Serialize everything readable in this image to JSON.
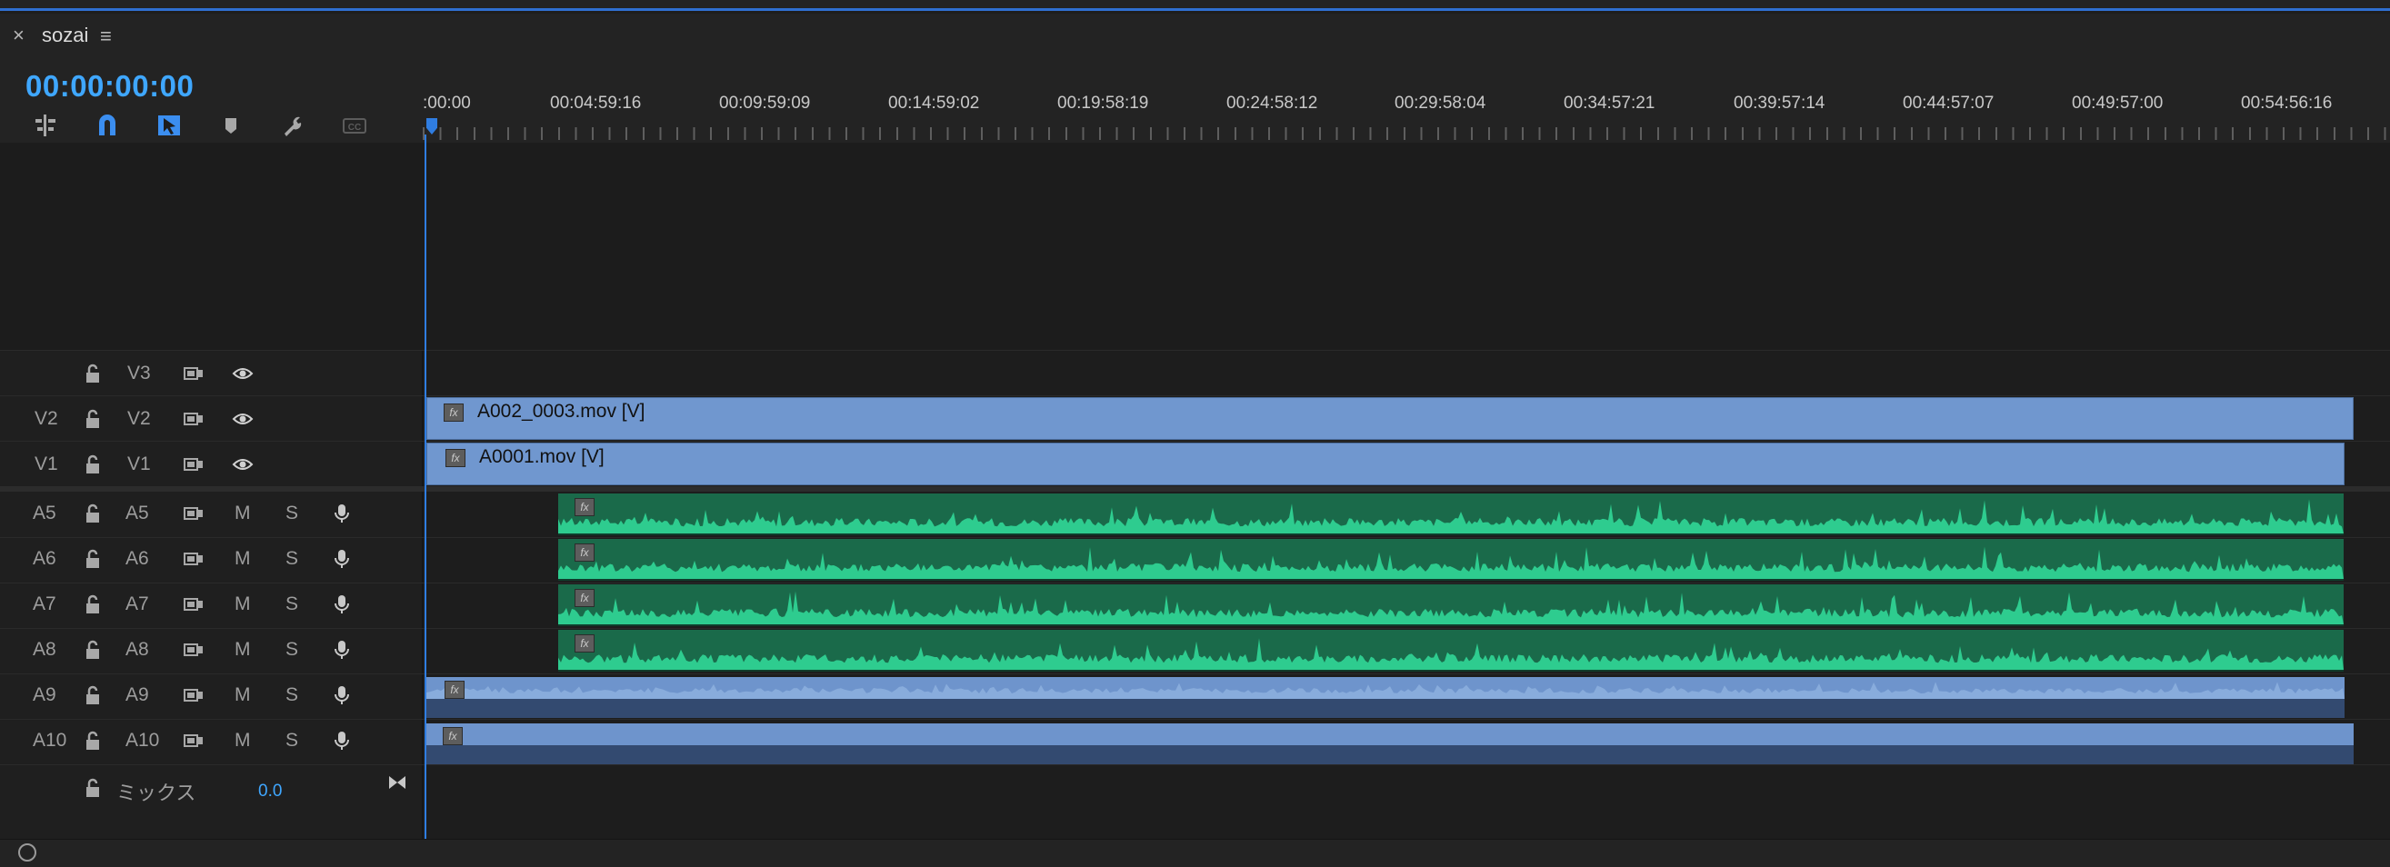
{
  "panel": {
    "close_icon": "×",
    "sequence_name": "sozai",
    "menu_icon": "≡"
  },
  "timecode": "00:00:00:00",
  "tools": [
    {
      "name": "insert-sequence-nest-icon",
      "active": false
    },
    {
      "name": "snap-magnet-icon",
      "active": true
    },
    {
      "name": "linked-selection-icon",
      "active": true
    },
    {
      "name": "add-marker-icon",
      "active": false
    },
    {
      "name": "timeline-settings-wrench-icon",
      "active": false
    },
    {
      "name": "closed-captions-icon",
      "active": false
    }
  ],
  "ruler_labels": [
    ":00:00",
    "00:04:59:16",
    "00:09:59:09",
    "00:14:59:02",
    "00:19:58:19",
    "00:24:58:12",
    "00:29:58:04",
    "00:34:57:21",
    "00:39:57:14",
    "00:44:57:07",
    "00:49:57:00",
    "00:54:56:16"
  ],
  "tracks": {
    "video": [
      {
        "src": "",
        "name": "V3"
      },
      {
        "src": "V2",
        "name": "V2"
      },
      {
        "src": "V1",
        "name": "V1"
      }
    ],
    "audio": [
      {
        "src": "A5",
        "name": "A5"
      },
      {
        "src": "A6",
        "name": "A6"
      },
      {
        "src": "A7",
        "name": "A7"
      },
      {
        "src": "A8",
        "name": "A8"
      },
      {
        "src": "A9",
        "name": "A9"
      },
      {
        "src": "A10",
        "name": "A10"
      }
    ],
    "mute_label": "M",
    "solo_label": "S"
  },
  "mix": {
    "label": "ミックス",
    "value": "0.0"
  },
  "clips": {
    "v2": {
      "fx": "fx",
      "label": "A002_0003.mov [V]"
    },
    "v1": {
      "fx": "fx",
      "label": "A0001.mov [V]"
    },
    "audio_fx": "fx"
  },
  "colors": {
    "accent": "#2f7de1",
    "video_clip": "#7097cf",
    "audio_clip": "#1a6a4a",
    "waveform": "#2ecc8f"
  }
}
